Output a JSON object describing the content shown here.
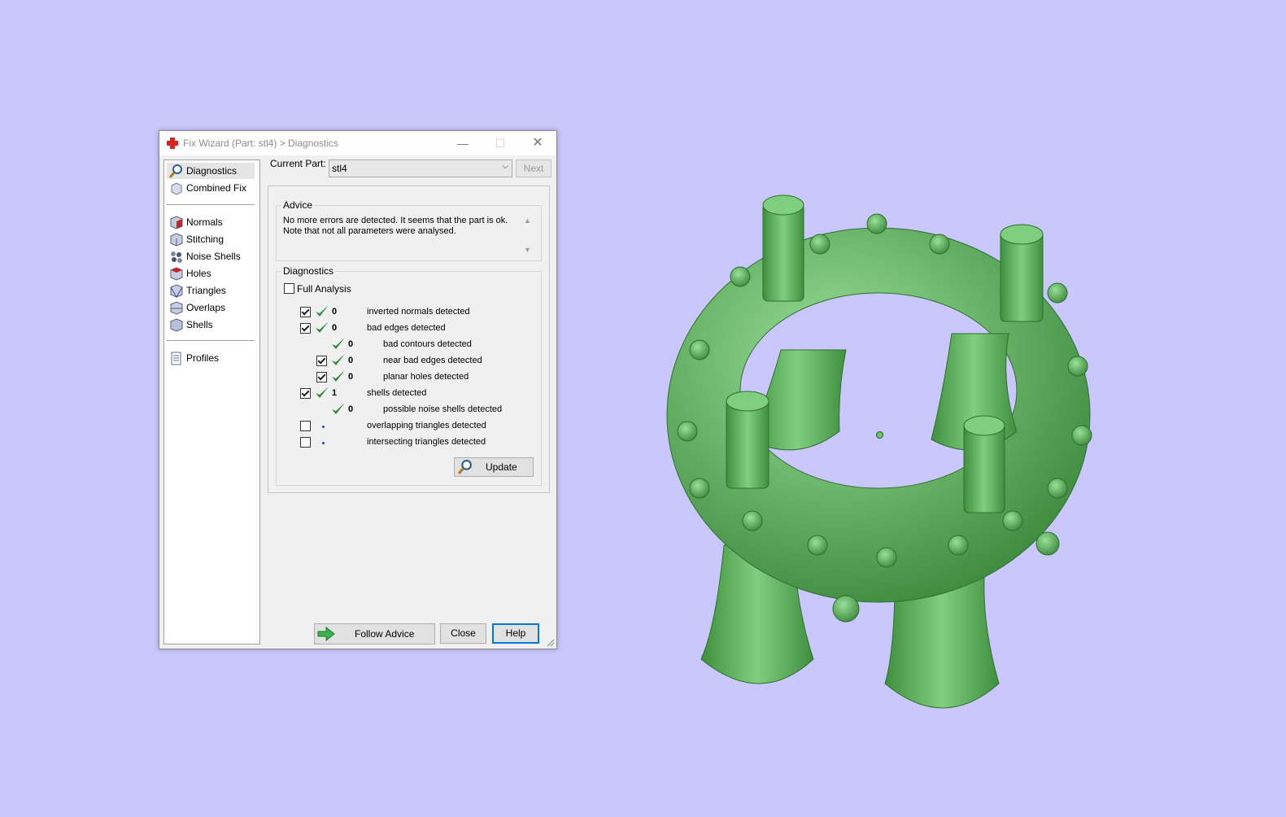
{
  "window": {
    "title": "Fix Wizard (Part: stl4) > Diagnostics",
    "minimize": "—",
    "maximize": "☐",
    "close": "✕"
  },
  "nav": {
    "items": [
      {
        "label": "Diagnostics",
        "icon": "magnifier-icon"
      },
      {
        "label": "Combined Fix",
        "icon": "combined-fix-icon"
      },
      {
        "label": "Normals",
        "icon": "normals-icon"
      },
      {
        "label": "Stitching",
        "icon": "stitching-icon"
      },
      {
        "label": "Noise Shells",
        "icon": "noise-shells-icon"
      },
      {
        "label": "Holes",
        "icon": "holes-icon"
      },
      {
        "label": "Triangles",
        "icon": "triangles-icon"
      },
      {
        "label": "Overlaps",
        "icon": "overlaps-icon"
      },
      {
        "label": "Shells",
        "icon": "shells-icon"
      },
      {
        "label": "Profiles",
        "icon": "profiles-icon"
      }
    ]
  },
  "current_part": {
    "label": "Current Part:",
    "value": "stl4",
    "next_label": "Next"
  },
  "advice": {
    "title": "Advice",
    "line1": "No more errors are detected. It seems that the part is ok.",
    "line2": "Note that not all parameters were analysed."
  },
  "diagnostics": {
    "title": "Diagnostics",
    "full_analysis_label": "Full Analysis",
    "rows": [
      {
        "count": "0",
        "label": "inverted normals detected"
      },
      {
        "count": "0",
        "label": "bad edges detected"
      },
      {
        "count": "0",
        "label": "bad contours detected"
      },
      {
        "count": "0",
        "label": "near bad edges detected"
      },
      {
        "count": "0",
        "label": "planar holes detected"
      },
      {
        "count": "1",
        "label": "shells detected"
      },
      {
        "count": "0",
        "label": "possible noise shells detected"
      },
      {
        "count": "",
        "label": "overlapping triangles detected"
      },
      {
        "count": "",
        "label": "intersecting triangles detected"
      }
    ],
    "update_label": "Update"
  },
  "footer": {
    "follow_label": "Follow Advice",
    "close_label": "Close",
    "help_label": "Help"
  },
  "colors": {
    "background": "#c9c7fb",
    "model_green": "#66b866",
    "check_green": "#2e8b3c"
  }
}
